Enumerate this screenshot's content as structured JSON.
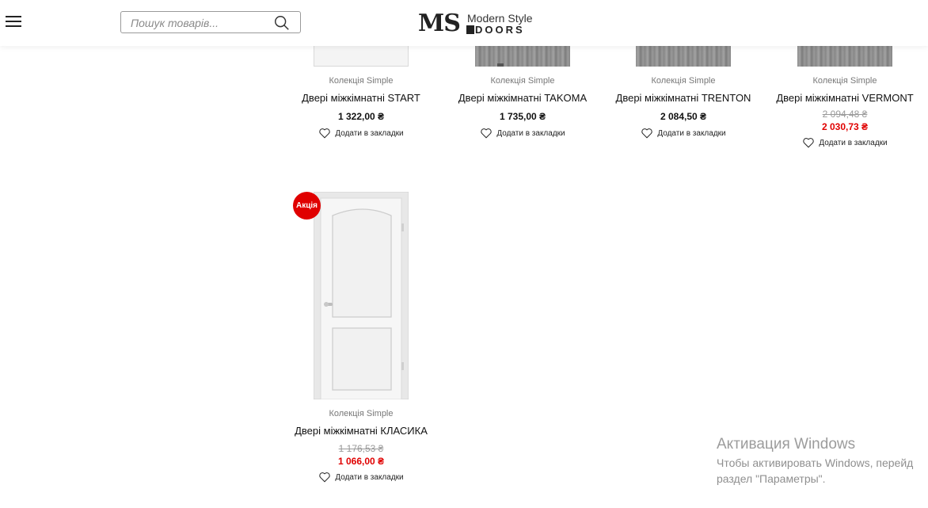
{
  "search": {
    "placeholder": "Пошук товарів..."
  },
  "logo": {
    "ms": "MS",
    "modern_style": "Modern Style",
    "doors": "DOORS"
  },
  "products": [
    {
      "collection": "Колекція Simple",
      "title": "Двері міжкімнатні START",
      "price": "1 322,00 ₴",
      "wishlist": "Додати в закладки"
    },
    {
      "collection": "Колекція Simple",
      "title": "Двері міжкімнатні TAKOMA",
      "price": "1 735,00 ₴",
      "wishlist": "Додати в закладки"
    },
    {
      "collection": "Колекція Simple",
      "title": "Двері міжкімнатні TRENTON",
      "price": "2 084,50 ₴",
      "wishlist": "Додати в закладки"
    },
    {
      "collection": "Колекція Simple",
      "title": "Двері міжкімнатні VERMONT",
      "old_price": "2 094,48 ₴",
      "new_price": "2 030,73 ₴",
      "wishlist": "Додати в закладки"
    },
    {
      "collection": "Колекція Simple",
      "title": "Двері міжкімнатні КЛАСИКА",
      "old_price": "1 176,53 ₴",
      "new_price": "1 066,00 ₴",
      "wishlist": "Додати в закладки",
      "badge": "Акція"
    }
  ],
  "windows_activation": {
    "title": "Активация Windows",
    "line1": "Чтобы активировать Windows, перейд",
    "line2": "раздел \"Параметры\"."
  },
  "colors": {
    "sale": "#e00000",
    "text": "#111111",
    "muted": "#777777"
  }
}
